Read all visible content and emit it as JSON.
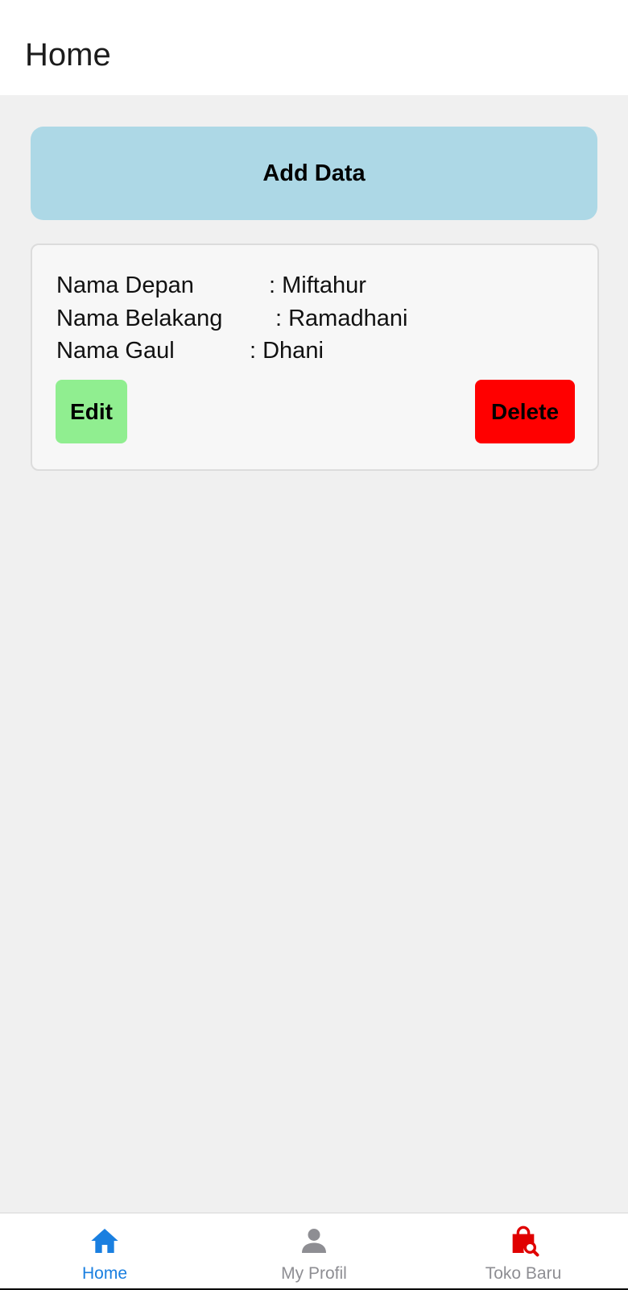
{
  "header": {
    "title": "Home"
  },
  "main": {
    "add_button_label": "Add Data",
    "card": {
      "rows": [
        {
          "label": "Nama Depan",
          "value": ": Miftahur"
        },
        {
          "label": "Nama Belakang",
          "value": ": Ramadhani"
        },
        {
          "label": "Nama Gaul",
          "value": ": Dhani"
        }
      ],
      "edit_label": "Edit",
      "delete_label": "Delete"
    }
  },
  "tabbar": {
    "tabs": [
      {
        "label": "Home",
        "icon": "home-icon",
        "active": true
      },
      {
        "label": "My Profil",
        "icon": "person-icon",
        "active": false
      },
      {
        "label": "Toko Baru",
        "icon": "shopping-bag-search-icon",
        "active": false
      }
    ]
  },
  "colors": {
    "add_button": "#add8e6",
    "edit_button": "#90ee90",
    "delete_button": "#ff0000",
    "tab_active": "#1a7fe0",
    "tab_inactive": "#8e8e93",
    "toko_icon": "#e00000"
  }
}
